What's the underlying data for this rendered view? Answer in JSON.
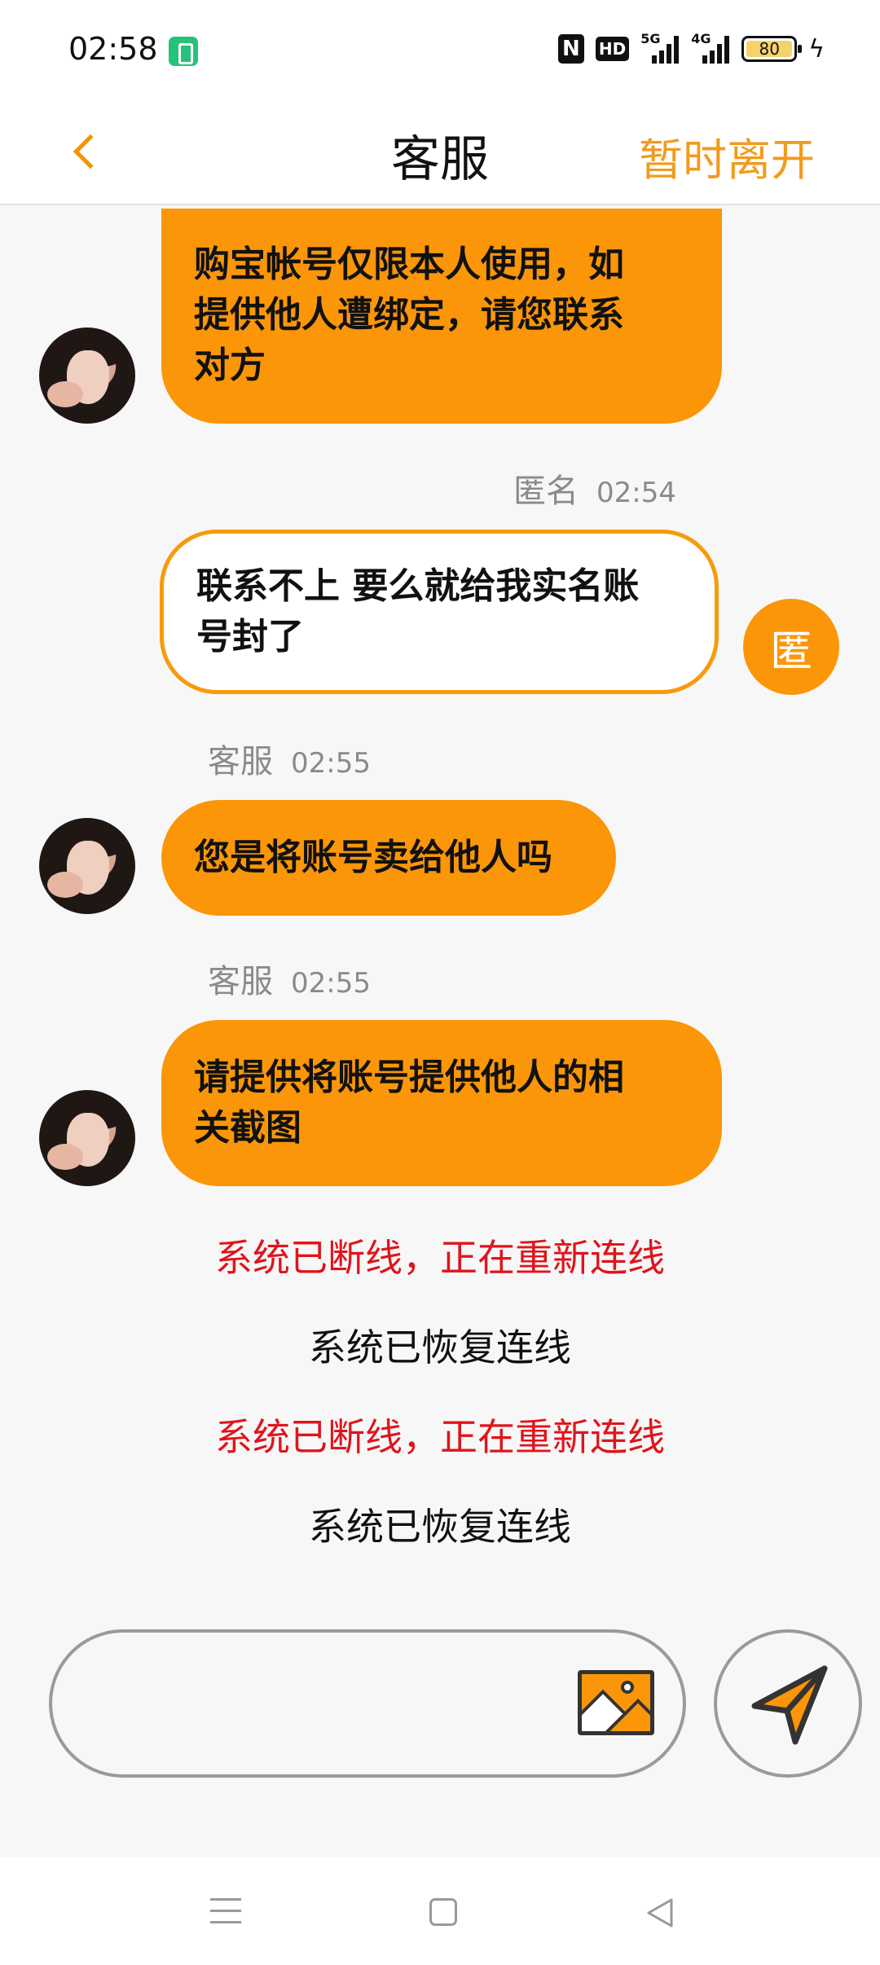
{
  "status_bar": {
    "time": "02:58",
    "nfc": "N",
    "hd": "HD",
    "net_5g": "5G",
    "net_4g": "4G",
    "battery": "80"
  },
  "header": {
    "title": "客服",
    "leave_label": "暂时离开"
  },
  "messages": [
    {
      "sender": "agent",
      "text_lines": [
        "购宝帐号仅限本人使用，如",
        "提供他人遭绑定，请您联系",
        "对方"
      ]
    },
    {
      "sender": "user",
      "name": "匿名",
      "time": "02:54",
      "text_lines": [
        "联系不上  要么就给我实名账",
        "号封了"
      ],
      "avatar_text": "匿"
    },
    {
      "sender": "agent",
      "name": "客服",
      "time": "02:55",
      "text_lines": [
        "您是将账号卖给他人吗"
      ]
    },
    {
      "sender": "agent",
      "name": "客服",
      "time": "02:55",
      "text_lines": [
        "请提供将账号提供他人的相",
        "关截图"
      ]
    }
  ],
  "system_messages": [
    {
      "text": "系统已断线，正在重新连线",
      "color": "#e0141c"
    },
    {
      "text": "系统已恢复连线",
      "color": "#111111"
    },
    {
      "text": "系统已断线，正在重新连线",
      "color": "#e0141c"
    },
    {
      "text": "系统已恢复连线",
      "color": "#111111"
    }
  ],
  "composer": {
    "placeholder": "",
    "image_icon": "image-icon",
    "send_icon": "send-icon"
  },
  "colors": {
    "accent": "#fb9608",
    "error": "#e0141c"
  }
}
